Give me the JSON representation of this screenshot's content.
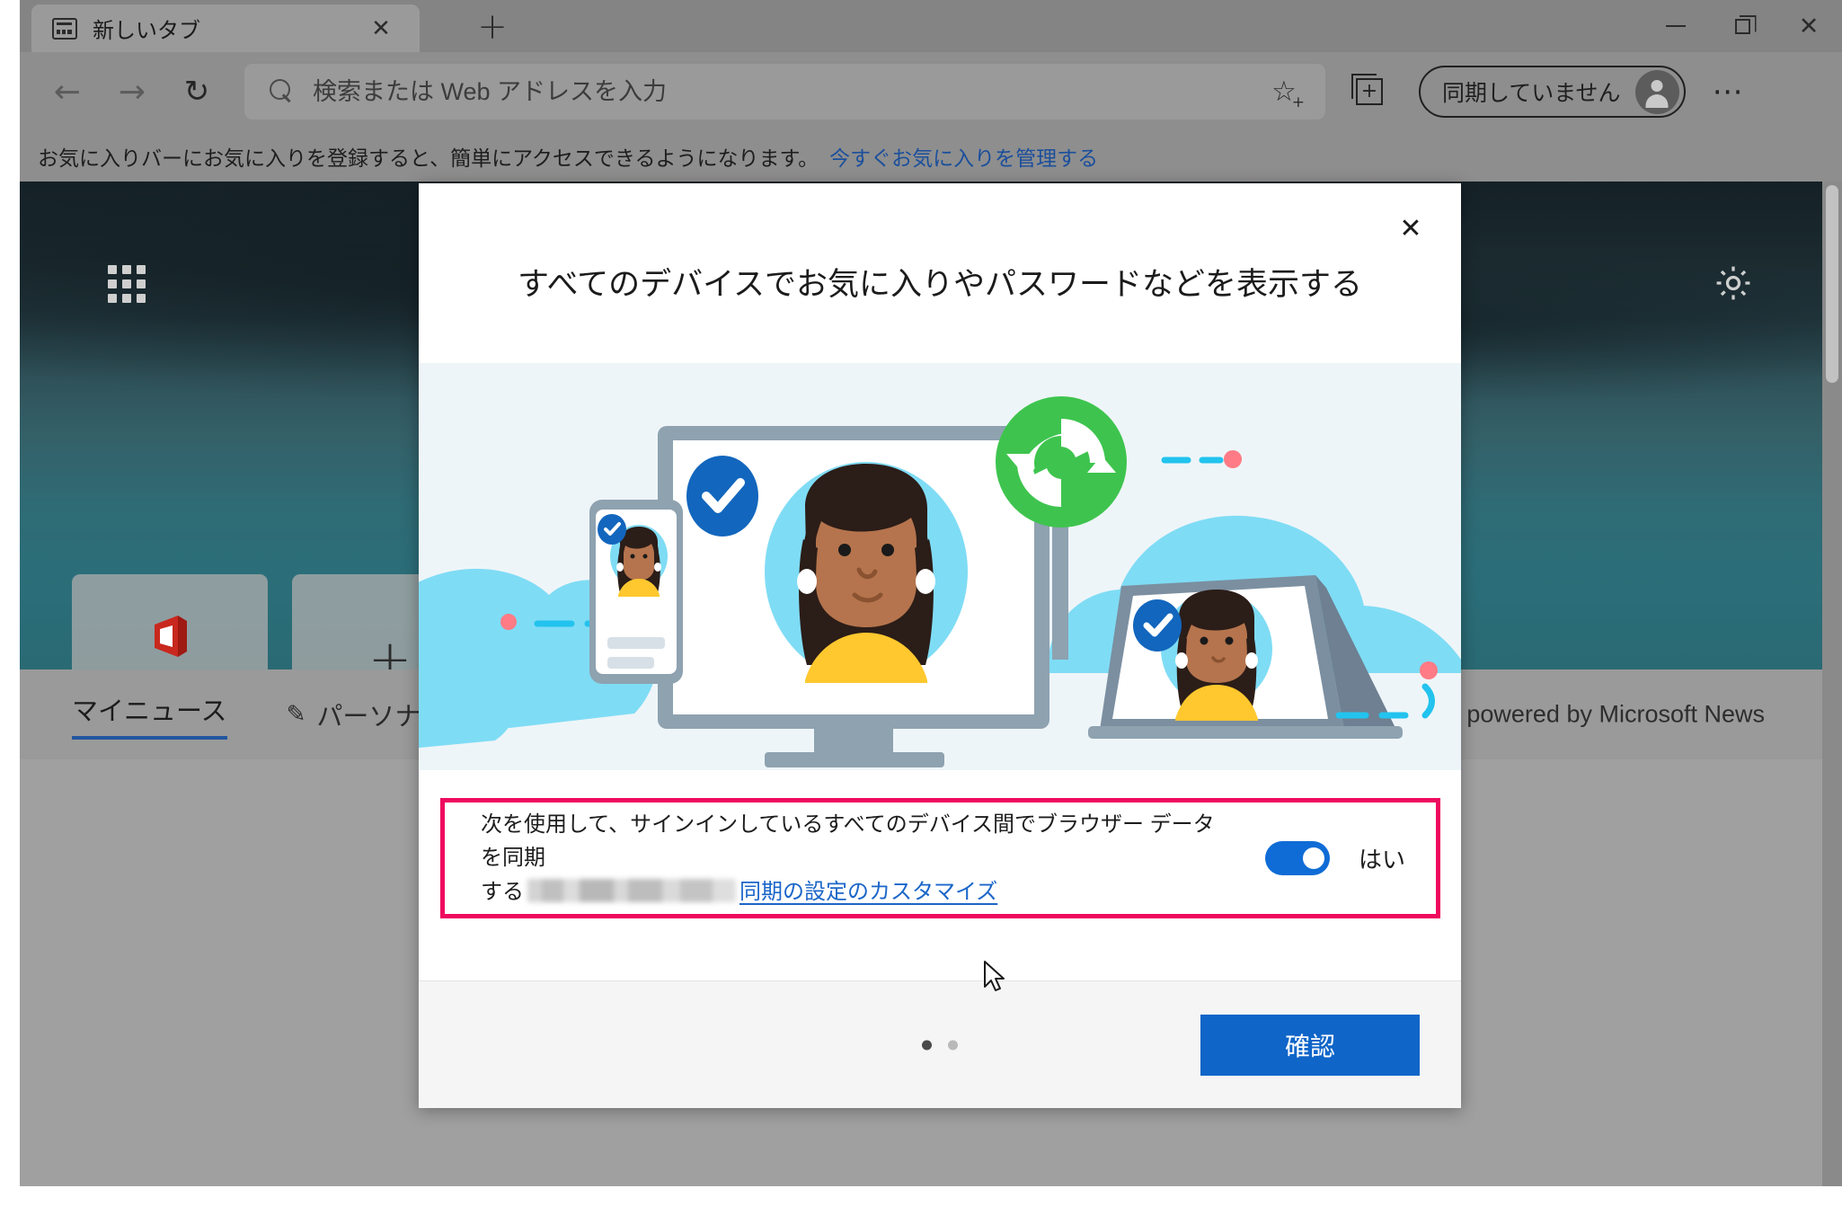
{
  "window": {
    "minimize_label": "minimize",
    "restore_label": "restore",
    "close_label": "close"
  },
  "tabs": [
    {
      "title": "新しいタブ",
      "favicon": "newtab-icon",
      "close_glyph": "✕"
    }
  ],
  "new_tab_button": {
    "glyph": "+",
    "name": "new-tab-button"
  },
  "toolbar": {
    "back_glyph": "←",
    "forward_glyph": "→",
    "reload_glyph": "↻",
    "omnibox": {
      "placeholder": "検索または Web アドレスを入力",
      "value": "",
      "search_icon": "search-icon",
      "favorite_icon": "add-favorite-star-icon"
    },
    "favorites_button": "favorites-list-icon",
    "collections_button": "collections-icon",
    "profile": {
      "label": "同期していません",
      "avatar": "person-avatar-icon"
    },
    "more_glyph": "⋯"
  },
  "favorites_bar": {
    "message": "お気に入りバーにお気に入りを登録すると、簡単にアクセスできるようになります。",
    "link": "今すぐお気に入りを管理する"
  },
  "new_tab_page": {
    "apps_grid_icon": "apps-grid-icon",
    "settings_icon": "gear-icon",
    "tiles": [
      {
        "label": "Office",
        "icon": "office-logo",
        "type": "shortcut"
      },
      {
        "label": "",
        "icon": "plus-icon",
        "type": "add"
      },
      {
        "label": "",
        "icon": "",
        "type": "empty"
      },
      {
        "label": "",
        "icon": "",
        "type": "empty"
      }
    ],
    "news": {
      "tab_label": "マイニュース",
      "personalize_label": "パーソナライズ",
      "personalize_icon": "pencil-icon",
      "powered_by": "powered by Microsoft News"
    }
  },
  "modal": {
    "close_glyph": "✕",
    "title": "すべてのデバイスでお気に入りやパスワードなどを表示する",
    "illustration": "sync-devices-illustration",
    "sync": {
      "text_line1": "次を使用して、サインインしているすべてのデバイス間でブラウザー データを同期",
      "text_line2_prefix": "する",
      "account_redacted": true,
      "customize_link": "同期の設定のカスタマイズ",
      "toggle_on": true,
      "toggle_label": "はい",
      "highlight_color": "#ee0a5f"
    },
    "footer": {
      "dots_total": 2,
      "dots_active_index": 0,
      "confirm_label": "確認",
      "confirm_color": "#0f65c8"
    }
  }
}
